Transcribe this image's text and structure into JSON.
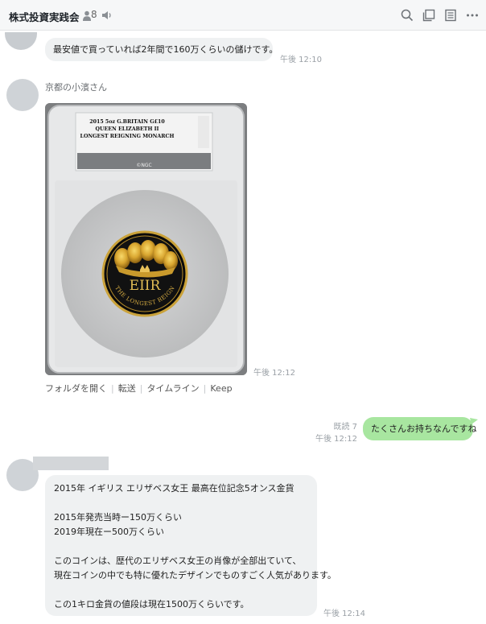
{
  "header": {
    "title": "株式投資実践会",
    "member_count": "8"
  },
  "messages": {
    "m1": {
      "text": "最安値で買っていれば2年間で160万くらいの儲けです。",
      "time": "午後 12:10"
    },
    "m2": {
      "sender": "京都の小濱さん",
      "image": {
        "label_line1": "2015 5oz G.BRITAIN G£10",
        "label_line2": "QUEEN ELIZABETH II",
        "label_line3": "LONGEST REIGNING MONARCH",
        "grader": "©NGC",
        "coin_text_top": "EIIR",
        "coin_text_bottom": "THE LONGEST REIGN"
      },
      "time": "午後 12:12",
      "actions": [
        "フォルダを開く",
        "転送",
        "タイムライン",
        "Keep"
      ]
    },
    "m3": {
      "read": "既読 7",
      "time": "午後 12:12",
      "text": "たくさんお持ちなんですね"
    },
    "m4": {
      "lines": [
        "2015年 イギリス エリザベス女王 最高在位記念5オンス金貨",
        "",
        "2015年発売当時ー150万くらい",
        "2019年現在ー500万くらい",
        "",
        "このコインは、歴代のエリザベス女王の肖像が全部出ていて、",
        "現在コインの中でも特に優れたデザインでものすごく人気があります。",
        "",
        "この1キロ金貨の値段は現在1500万くらいです。"
      ],
      "time": "午後 12:14"
    }
  },
  "colors": {
    "bubble_grey": "#eff1f2",
    "bubble_green": "#a8e6a0",
    "header_bg": "#f6f7f8"
  }
}
